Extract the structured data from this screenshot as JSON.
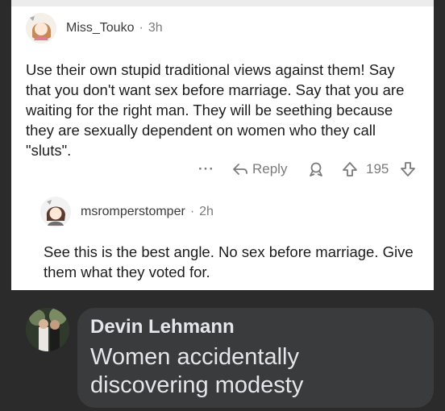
{
  "comment1": {
    "username": "Miss_Touko",
    "separator": "·",
    "time": "3h",
    "body": "Use their own stupid traditional views against them! Say that you don't want sex before marriage. Say that you are waiting for the right man. They will be seething because they are sexually dependent on women who they call \"sluts\".",
    "actions": {
      "more": "···",
      "reply_label": "Reply",
      "vote_count": "195"
    }
  },
  "comment2": {
    "username": "msromperstomper",
    "separator": "·",
    "time": "2h",
    "body": "See this is the best angle. No sex before marriage. Give them what they voted for."
  },
  "facebook_comment": {
    "name": "Devin Lehmann",
    "text": "Women accidentally discovering modesty"
  },
  "colors": {
    "card_bg": "#ffffff",
    "dark_bg": "#2b2b2b",
    "bubble_bg": "#3a3b3c",
    "meta_gray": "#7b7b7b"
  }
}
